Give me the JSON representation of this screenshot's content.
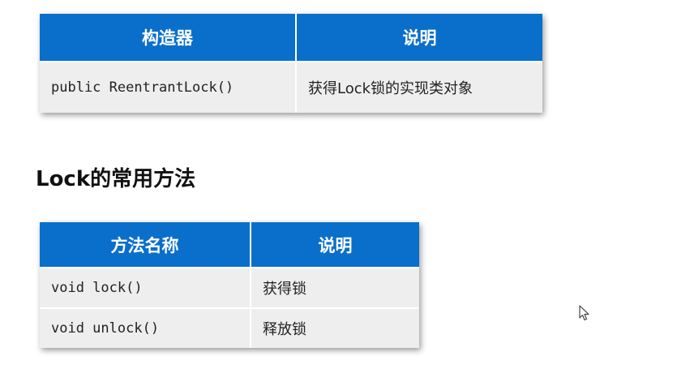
{
  "constructor_table": {
    "headers": [
      "构造器",
      "说明"
    ],
    "rows": [
      [
        "public ReentrantLock()",
        "获得Lock锁的实现类对象"
      ]
    ]
  },
  "section_title": "Lock的常用方法",
  "method_table": {
    "headers": [
      "方法名称",
      "说明"
    ],
    "rows": [
      [
        "void lock()",
        "获得锁"
      ],
      [
        "void unlock()",
        "释放锁"
      ]
    ]
  },
  "colors": {
    "header_bg": "#0a6fcb",
    "header_text": "#ffffff",
    "cell_bg": "#eeeeee"
  },
  "icons": [
    "mouse-cursor-icon"
  ]
}
